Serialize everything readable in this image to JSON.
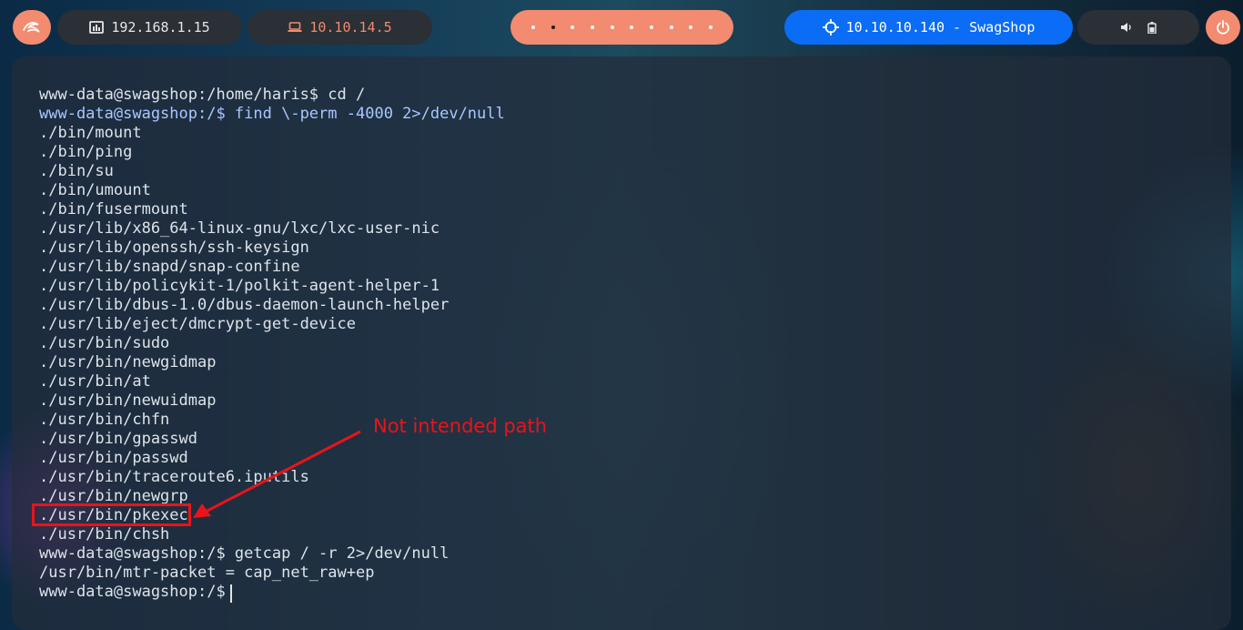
{
  "topbar": {
    "launcher_icon": "kali-dragon-icon",
    "host_ip": "192.168.1.15",
    "vpn_ip": "10.10.14.5",
    "workspaces_count": 10,
    "active_workspace": 2,
    "target_label": "10.10.10.140 - SwagShop",
    "volume_icon": "speaker-icon",
    "battery_icon": "battery-icon",
    "power_icon": "power-icon"
  },
  "terminal": {
    "lines": [
      "www-data@swagshop:/home/haris$ cd /",
      "www-data@swagshop:/$ find \\-perm -4000 2>/dev/null",
      "./bin/mount",
      "./bin/ping",
      "./bin/su",
      "./bin/umount",
      "./bin/fusermount",
      "./usr/lib/x86_64-linux-gnu/lxc/lxc-user-nic",
      "./usr/lib/openssh/ssh-keysign",
      "./usr/lib/snapd/snap-confine",
      "./usr/lib/policykit-1/polkit-agent-helper-1",
      "./usr/lib/dbus-1.0/dbus-daemon-launch-helper",
      "./usr/lib/eject/dmcrypt-get-device",
      "./usr/bin/sudo",
      "./usr/bin/newgidmap",
      "./usr/bin/at",
      "./usr/bin/newuidmap",
      "./usr/bin/chfn",
      "./usr/bin/gpasswd",
      "./usr/bin/passwd",
      "./usr/bin/traceroute6.iputils",
      "./usr/bin/newgrp",
      "./usr/bin/pkexec",
      "./usr/bin/chsh",
      "www-data@swagshop:/$ getcap / -r 2>/dev/null",
      "/usr/bin/mtr-packet = cap_net_raw+ep",
      "www-data@swagshop:/$ "
    ]
  },
  "annotation": {
    "text": "Not intended path",
    "color": "#e8141a"
  },
  "colors": {
    "accent": "#f28b6f",
    "target_pill": "#0b6cf5",
    "pill_dark": "#2b2f36"
  }
}
